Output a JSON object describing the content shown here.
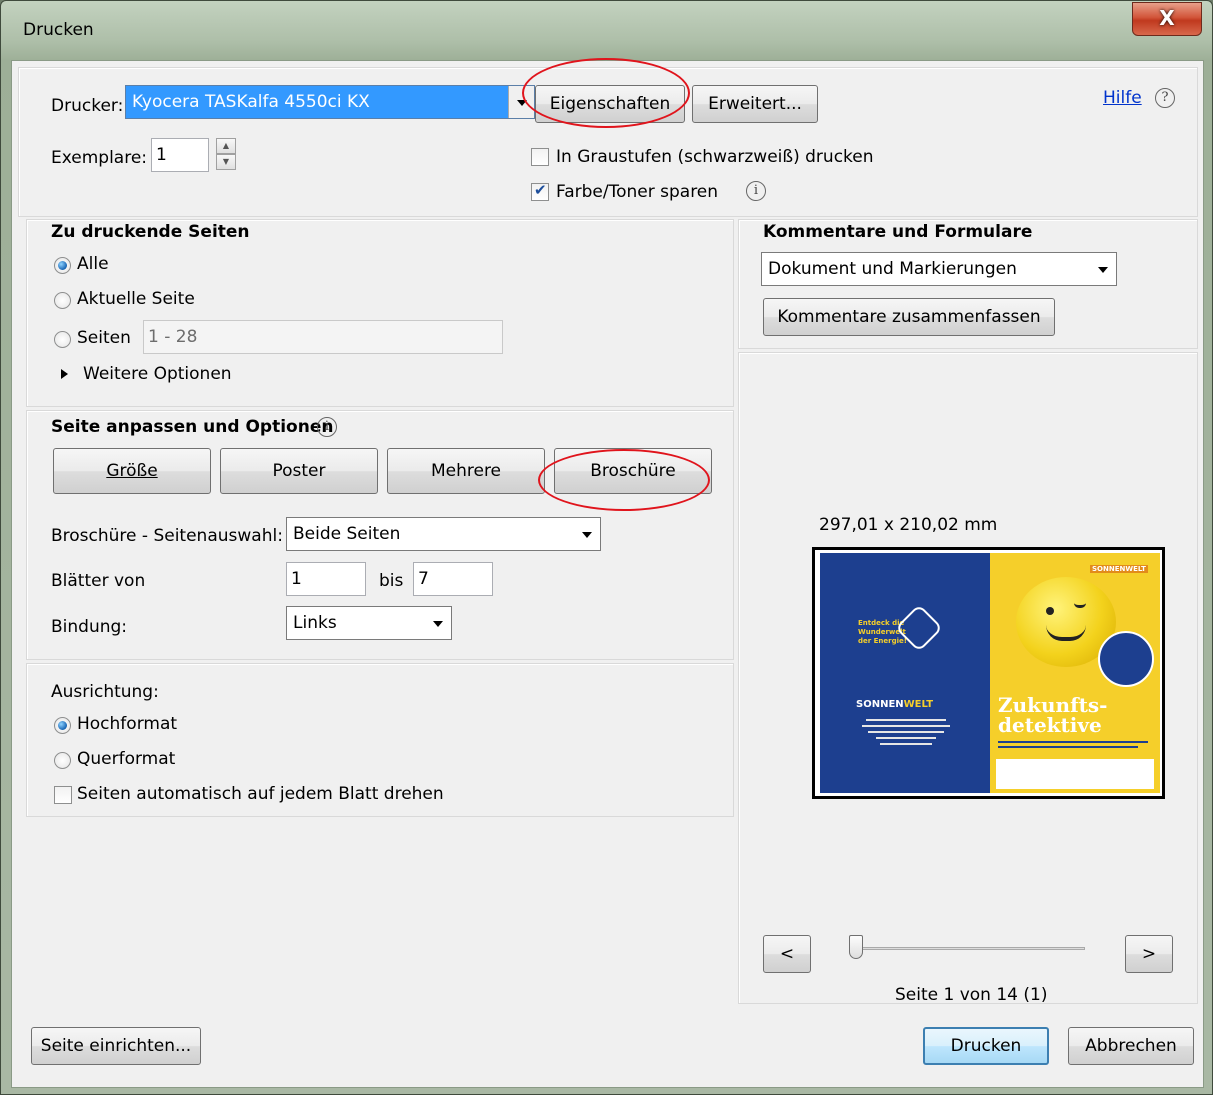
{
  "window": {
    "title": "Drucken",
    "close_label": "X"
  },
  "printer": {
    "label": "Drucker:",
    "selected": "Kyocera TASKalfa 4550ci KX",
    "properties_button": "Eigenschaften",
    "advanced_button": "Erweitert...",
    "help_link": "Hilfe",
    "copies_label": "Exemplare:",
    "copies_value": "1",
    "grayscale_label": "In Graustufen (schwarzweiß) drucken",
    "grayscale_checked": false,
    "toner_label": "Farbe/Toner sparen",
    "toner_checked": true
  },
  "pages": {
    "heading": "Zu druckende Seiten",
    "all_label": "Alle",
    "current_label": "Aktuelle Seite",
    "pages_label": "Seiten",
    "pages_value": "1 - 28",
    "more_options": "Weitere Optionen"
  },
  "fit": {
    "heading": "Seite anpassen und Optionen",
    "size_button": "Größe",
    "poster_button": "Poster",
    "multiple_button": "Mehrere",
    "booklet_button": "Broschüre",
    "booklet_subset_label": "Broschüre - Seitenauswahl:",
    "booklet_subset_value": "Beide Seiten",
    "sheets_label": "Blätter von",
    "sheets_from": "1",
    "sheets_to_label": "bis",
    "sheets_to": "7",
    "binding_label": "Bindung:",
    "binding_value": "Links"
  },
  "orientation": {
    "heading": "Ausrichtung:",
    "portrait_label": "Hochformat",
    "landscape_label": "Querformat",
    "autorotate_label": "Seiten automatisch auf jedem Blatt drehen"
  },
  "comments": {
    "heading": "Kommentare und Formulare",
    "selected": "Dokument und Markierungen",
    "summarize_button": "Kommentare zusammenfassen"
  },
  "preview": {
    "size_text": "297,01 x 210,02 mm",
    "prev_button": "<",
    "next_button": ">",
    "page_status": "Seite 1 von 14 (1)",
    "left_page": {
      "tagline": "Entdeck die Wunderwelt der Energie!",
      "brand_a": "SONNEN",
      "brand_b": "WELT"
    },
    "right_page": {
      "corner_brand": "SONNENWELT",
      "headline_1": "Zukunfts-",
      "headline_2": "detektive"
    }
  },
  "footer": {
    "page_setup_button": "Seite einrichten...",
    "print_button": "Drucken",
    "cancel_button": "Abbrechen"
  },
  "colors": {
    "highlight": "#3399ff",
    "annotation_red": "#e0141c",
    "brochure_blue": "#1d3f8f",
    "brochure_yellow": "#f5cf2a"
  }
}
